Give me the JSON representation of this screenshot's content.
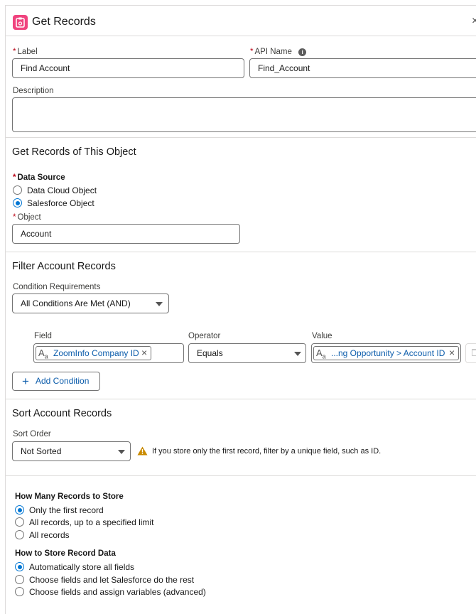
{
  "header": {
    "title": "Get Records",
    "close_icon": "close-icon"
  },
  "label_field": {
    "label": "Label",
    "value": "Find Account"
  },
  "api_name_field": {
    "label": "API Name",
    "value": "Find_Account"
  },
  "description_field": {
    "label": "Description",
    "value": ""
  },
  "object_section": {
    "title": "Get Records of This Object",
    "data_source_label": "Data Source",
    "options": [
      {
        "label": "Data Cloud Object",
        "selected": false
      },
      {
        "label": "Salesforce Object",
        "selected": true
      }
    ],
    "object_label": "Object",
    "object_value": "Account"
  },
  "filter_section": {
    "title": "Filter Account Records",
    "condition_label": "Condition Requirements",
    "condition_value": "All Conditions Are Met (AND)",
    "field_header": "Field",
    "operator_header": "Operator",
    "value_header": "Value",
    "condition": {
      "field": "ZoomInfo Company ID",
      "operator": "Equals",
      "value": "...ng Opportunity > Account ID"
    },
    "add_condition_label": "Add Condition"
  },
  "sort_section": {
    "title": "Sort Account Records",
    "sort_order_label": "Sort Order",
    "sort_order_value": "Not Sorted",
    "warning_text": "If you store only the first record, filter by a unique field, such as ID.",
    "warning_color": "#c98a00"
  },
  "store_section": {
    "how_many_label": "How Many Records to Store",
    "how_many_options": [
      {
        "label": "Only the first record",
        "selected": true
      },
      {
        "label": "All records, up to a specified limit",
        "selected": false
      },
      {
        "label": "All records",
        "selected": false
      }
    ],
    "how_store_label": "How to Store Record Data",
    "how_store_options": [
      {
        "label": "Automatically store all fields",
        "selected": true
      },
      {
        "label": "Choose fields and let Salesforce do the rest",
        "selected": false
      },
      {
        "label": "Choose fields and assign variables (advanced)",
        "selected": false
      }
    ]
  },
  "colors": {
    "accent": "#0176d3",
    "link": "#0b5cab",
    "header_icon": "#f0437e",
    "required": "#ba0517"
  }
}
